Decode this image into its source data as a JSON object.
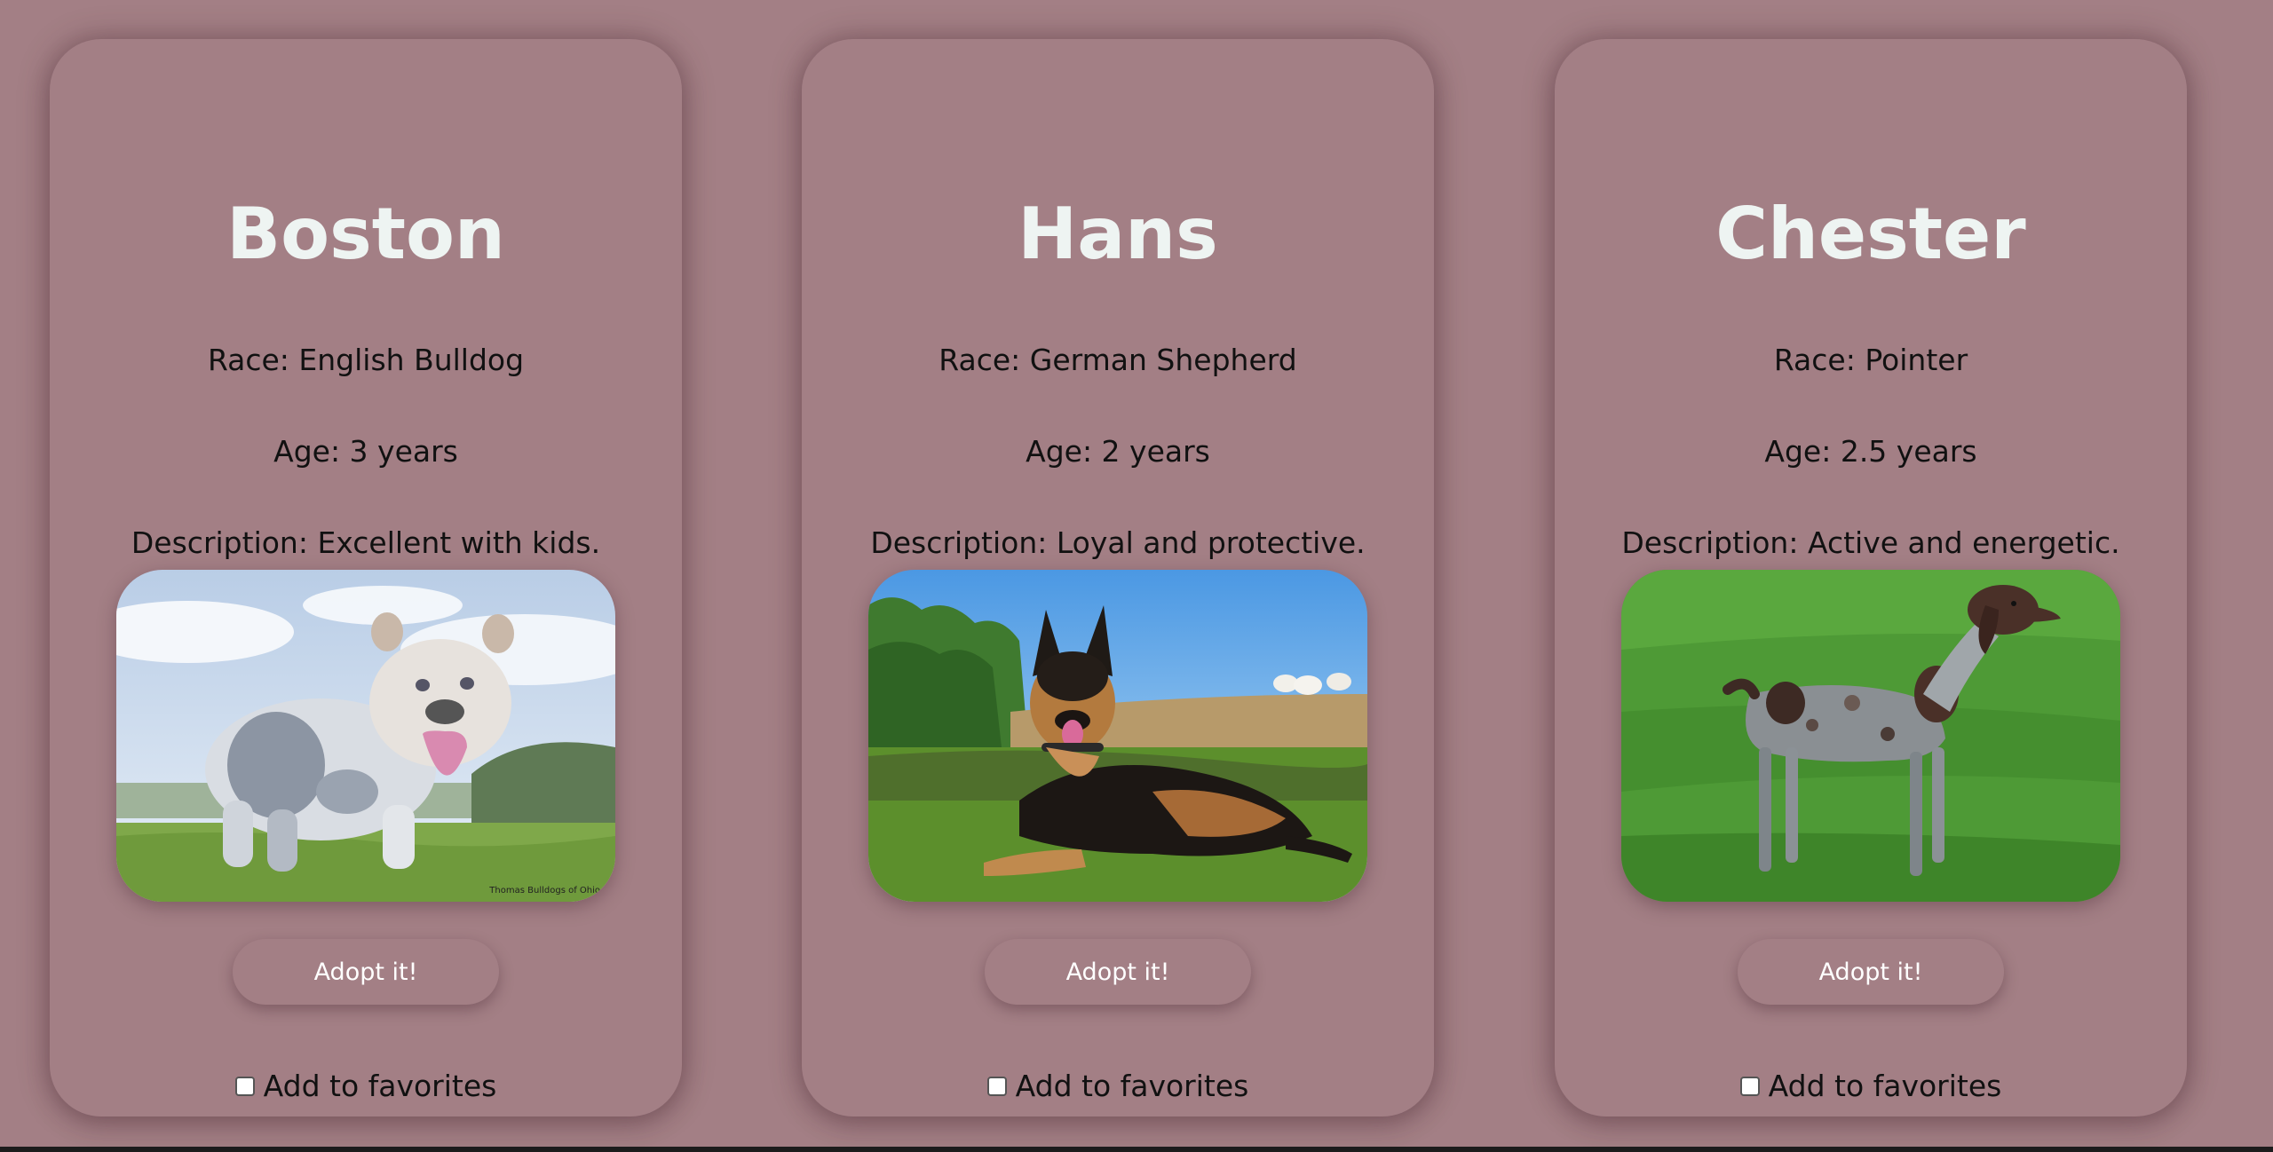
{
  "theme": {
    "background": "#a37f85",
    "name_color": "#eef4f2",
    "text_color": "#111111"
  },
  "cards": [
    {
      "name": "Boston",
      "race": "Race: English Bulldog",
      "age": "Age: 3 years",
      "description": "Description: Excellent with kids.",
      "image_alt": "English Bulldog standing on grass",
      "photo_watermark": "Thomas Bulldogs of Ohio",
      "adopt_label": "Adopt it!",
      "favorite_label": "Add to favorites",
      "favorite_checked": false
    },
    {
      "name": "Hans",
      "race": "Race: German Shepherd",
      "age": "Age: 2 years",
      "description": "Description: Loyal and protective.",
      "image_alt": "German Shepherd lying on grass",
      "adopt_label": "Adopt it!",
      "favorite_label": "Add to favorites",
      "favorite_checked": false
    },
    {
      "name": "Chester",
      "race": "Race: Pointer",
      "age": "Age: 2.5 years",
      "description": "Description: Active and energetic.",
      "image_alt": "Pointer standing in a green field",
      "adopt_label": "Adopt it!",
      "favorite_label": "Add to favorites",
      "favorite_checked": false
    }
  ]
}
